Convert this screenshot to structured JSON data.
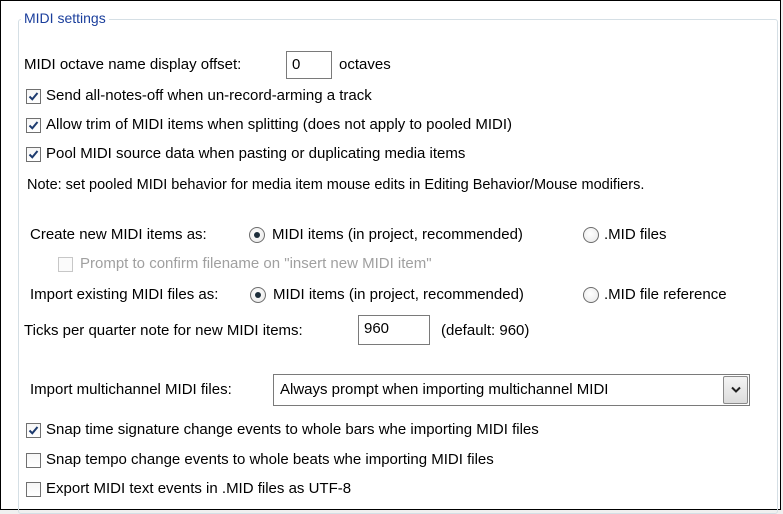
{
  "group": {
    "title": "MIDI settings"
  },
  "octave_offset": {
    "label": "MIDI octave name display offset:",
    "value": "0",
    "suffix": "octaves"
  },
  "checkboxes": {
    "send_notes_off": {
      "label": "Send all-notes-off when un-record-arming a track",
      "checked": true
    },
    "allow_trim": {
      "label": "Allow trim of MIDI items when splitting (does not apply to pooled MIDI)",
      "checked": true
    },
    "pool_source": {
      "label": "Pool MIDI source data when pasting or duplicating media items",
      "checked": true
    },
    "prompt_filename": {
      "label": "Prompt to confirm filename on \"insert new MIDI item\"",
      "checked": false,
      "disabled": true
    },
    "snap_timesig": {
      "label": "Snap time signature change events to whole bars whe importing MIDI files",
      "checked": true
    },
    "snap_tempo": {
      "label": "Snap tempo change events to whole beats whe importing MIDI files",
      "checked": false
    },
    "export_utf8": {
      "label": "Export MIDI text events in .MID files as UTF-8",
      "checked": false
    }
  },
  "note": "Note: set pooled MIDI behavior for media item mouse edits in Editing Behavior/Mouse modifiers.",
  "create_new": {
    "label": "Create new MIDI items as:",
    "options": [
      "MIDI items (in project, recommended)",
      ".MID files"
    ],
    "selected": 0
  },
  "import_existing": {
    "label": "Import existing MIDI files as:",
    "options": [
      "MIDI items (in project, recommended)",
      ".MID file reference"
    ],
    "selected": 0
  },
  "ticks": {
    "label": "Ticks per quarter note for new MIDI items:",
    "value": "960",
    "hint": "(default: 960)"
  },
  "multichannel": {
    "label": "Import multichannel MIDI files:",
    "selected": "Always prompt when importing multichannel MIDI"
  }
}
